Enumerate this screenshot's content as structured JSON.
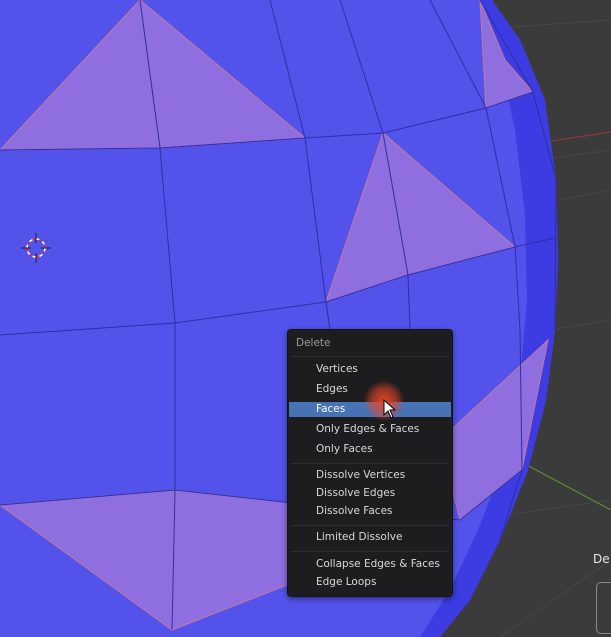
{
  "menu": {
    "title": "Delete",
    "items": [
      {
        "label": "Vertices"
      },
      {
        "label": "Edges"
      },
      {
        "label": "Faces"
      },
      {
        "label": "Only Edges & Faces"
      },
      {
        "label": "Only Faces"
      },
      {
        "label": "Dissolve Vertices"
      },
      {
        "label": "Dissolve Edges"
      },
      {
        "label": "Dissolve Faces"
      },
      {
        "label": "Limited Dissolve"
      },
      {
        "label": "Collapse Edges & Faces"
      },
      {
        "label": "Edge Loops"
      }
    ],
    "active_item": "Faces"
  },
  "side_panel": {
    "title_fragment": "De"
  },
  "colors": {
    "viewport_bg": "#3a3a3a",
    "face": "#5353ec",
    "selected_face": "#8f6ee0",
    "menu_bg": "#1d1d1f",
    "menu_highlight": "#4772b3"
  },
  "icons": [
    "3d-cursor-icon",
    "mouse-pointer-icon"
  ]
}
